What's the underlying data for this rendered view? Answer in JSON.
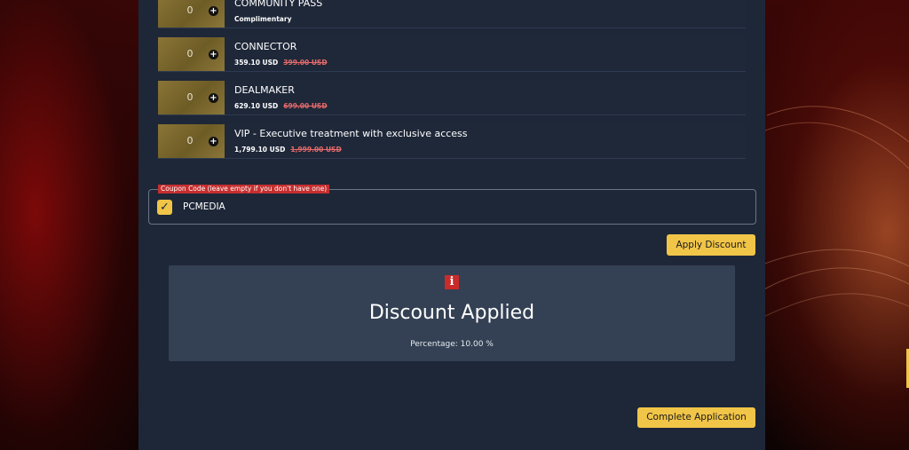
{
  "tickets": [
    {
      "qty": "0",
      "name": "COMMUNITY PASS",
      "price": "Complimentary",
      "orig": ""
    },
    {
      "qty": "0",
      "name": "CONNECTOR",
      "price": "359.10 USD",
      "orig": "399.00 USD"
    },
    {
      "qty": "0",
      "name": "DEALMAKER",
      "price": "629.10 USD",
      "orig": "699.00 USD"
    },
    {
      "qty": "0",
      "name": "VIP - Executive treatment with exclusive access",
      "price": "1,799.10 USD",
      "orig": "1,999.00 USD"
    }
  ],
  "coupon": {
    "legend": "Coupon Code (leave empty if you don't have one)",
    "value": "PCMEDIA",
    "checked": true
  },
  "apply_button": "Apply Discount",
  "notice": {
    "icon": "info-icon",
    "title": "Discount Applied",
    "subtitle": "Percentage: 10.00 %"
  },
  "complete_button": "Complete Application",
  "colors": {
    "panel": "#1e2738",
    "accent": "#f1c548",
    "notice_bg": "#344154",
    "alert_red": "#c62f2f"
  }
}
